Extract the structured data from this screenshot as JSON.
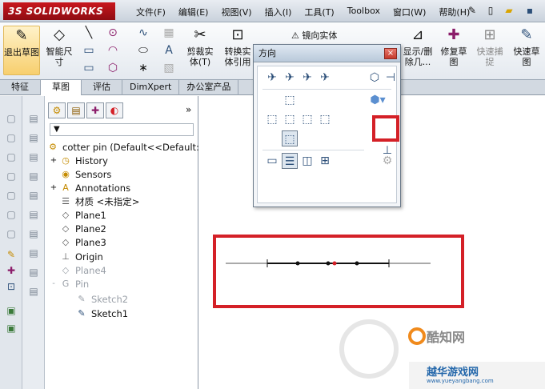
{
  "app": {
    "logo_text": "3S SOLIDWORKS",
    "menus": [
      "文件(F)",
      "编辑(E)",
      "视图(V)",
      "插入(I)",
      "工具(T)",
      "Toolbox",
      "窗口(W)",
      "帮助(H)"
    ]
  },
  "ribbon": {
    "exit_sketch": "退出草图",
    "smart_dim": "智能尺寸",
    "trim": "剪裁实体(T)",
    "convert": "转换实体引用",
    "mirror": "镜向实体",
    "display_delete": "显示/删除几...",
    "repair": "修复草图",
    "quick_snap": "快速捕捉",
    "rapid_sketch": "快速草图"
  },
  "tabs": [
    "特征",
    "草图",
    "评估",
    "DimXpert",
    "办公室产品"
  ],
  "active_tab": "草图",
  "tree": {
    "root": "cotter pin  (Default<<Default:",
    "nodes": [
      {
        "label": "History",
        "icon": "history-icon",
        "expand": "+"
      },
      {
        "label": "Sensors",
        "icon": "sensor-icon",
        "expand": ""
      },
      {
        "label": "Annotations",
        "icon": "annotation-icon",
        "expand": "+"
      },
      {
        "label": "材质 <未指定>",
        "icon": "material-icon",
        "expand": ""
      },
      {
        "label": "Plane1",
        "icon": "plane-icon",
        "expand": ""
      },
      {
        "label": "Plane2",
        "icon": "plane-icon",
        "expand": ""
      },
      {
        "label": "Plane3",
        "icon": "plane-icon",
        "expand": ""
      },
      {
        "label": "Origin",
        "icon": "origin-icon",
        "expand": ""
      },
      {
        "label": "Plane4",
        "icon": "plane-icon",
        "expand": ""
      },
      {
        "label": "Pin",
        "icon": "feature-icon",
        "expand": "-"
      },
      {
        "label": "Sketch2",
        "icon": "sketch-icon",
        "expand": ""
      },
      {
        "label": "Sketch1",
        "icon": "sketch-icon",
        "expand": ""
      }
    ]
  },
  "dialog": {
    "title": "方向",
    "close": "×"
  },
  "watermark": {
    "brand1": "酷知网",
    "brand2": "越华游戏网",
    "url": "www.yueyangbang.com"
  },
  "colors": {
    "highlight": "#d42027",
    "ribbon_active": "#f7cf6e"
  }
}
